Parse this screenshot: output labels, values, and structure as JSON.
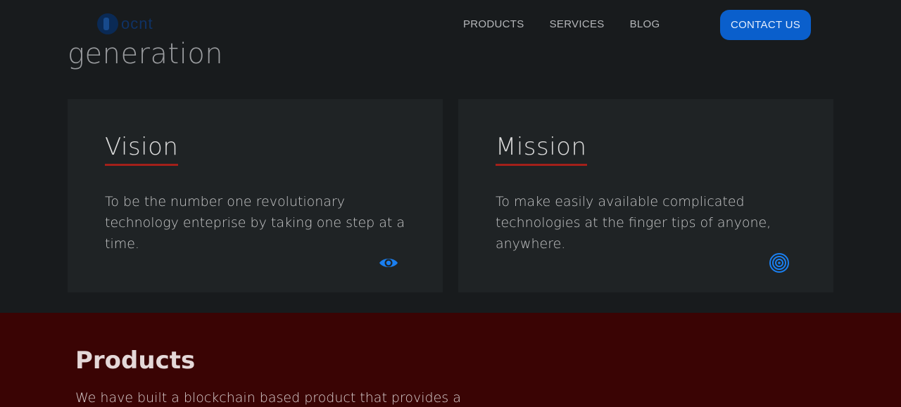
{
  "header": {
    "logo_text": "ocnt",
    "nav": [
      {
        "label": "PRODUCTS"
      },
      {
        "label": "SERVICES"
      },
      {
        "label": "BLOG"
      }
    ],
    "contact_label": "CONTACT US"
  },
  "hero": {
    "fragment": "generation"
  },
  "cards": {
    "vision": {
      "title": "Vision",
      "text": "To be the number one revolutionary technology enteprise by taking one step at a time.",
      "icon": "eye-icon"
    },
    "mission": {
      "title": "Mission",
      "text": "To make easily available complicated technologies at the finger tips of anyone, anywhere.",
      "icon": "target-icon"
    }
  },
  "products": {
    "title": "Products",
    "text": "We have built a blockchain based product that provides a"
  },
  "colors": {
    "background": "#181b1d",
    "card": "#1f2325",
    "accent_blue": "#0a5fcc",
    "underline_red": "#a3201a",
    "products_bg": "#3a0404"
  }
}
